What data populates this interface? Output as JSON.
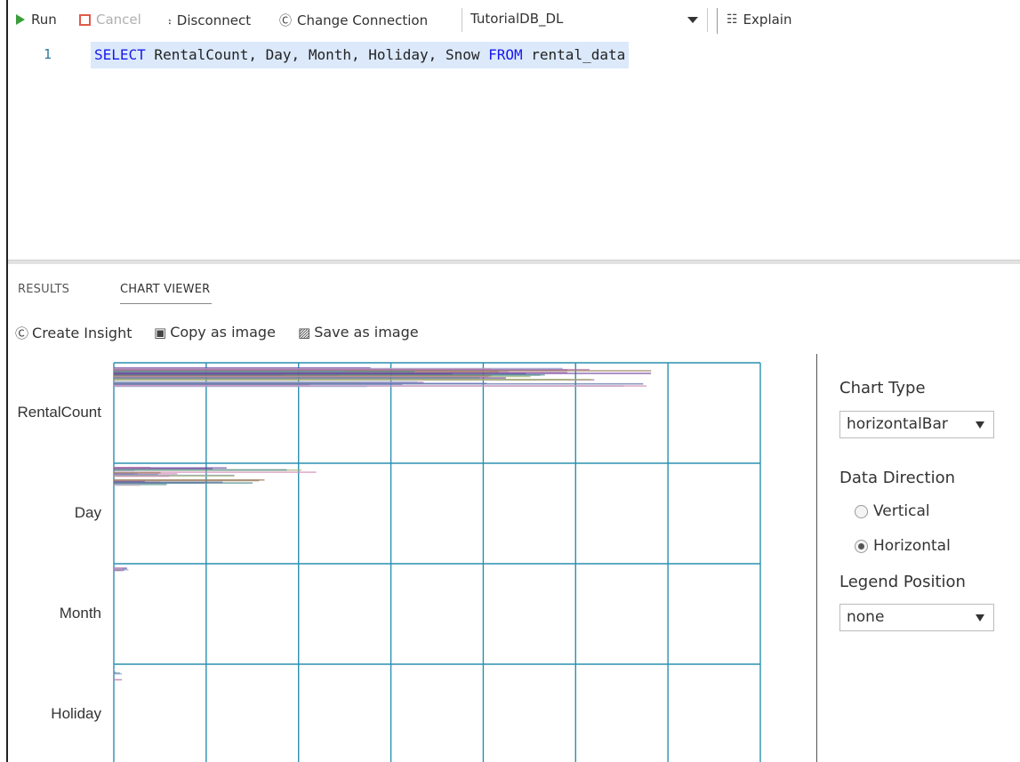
{
  "toolbar": {
    "run_label": "Run",
    "cancel_label": "Cancel",
    "disconnect_label": "Disconnect",
    "change_connection_label": "Change Connection",
    "database": "TutorialDB_DL",
    "explain_label": "Explain"
  },
  "editor": {
    "line_number": "1",
    "query": {
      "select_keyword": "SELECT",
      "columns": " RentalCount, Day, Month, Holiday, Snow ",
      "from_keyword": "FROM",
      "table": " rental_data"
    }
  },
  "results_panel": {
    "tabs": [
      {
        "label": "RESULTS",
        "active": false
      },
      {
        "label": "CHART VIEWER",
        "active": true
      }
    ],
    "actions": {
      "create_insight": "Create Insight",
      "copy_as_image": "Copy as image",
      "save_as_image": "Save as image"
    }
  },
  "chart_settings": {
    "chart_type_label": "Chart Type",
    "chart_type_value": "horizontalBar",
    "data_direction_label": "Data Direction",
    "direction_options": [
      "Vertical",
      "Horizontal"
    ],
    "direction_selected": "Horizontal",
    "legend_position_label": "Legend Position",
    "legend_position_value": "none"
  },
  "chart_data": {
    "type": "bar",
    "orientation": "horizontal",
    "categories": [
      "RentalCount",
      "Day",
      "Month",
      "Holiday"
    ],
    "grid": true,
    "gridline_color": "#2a8fb0",
    "legend": "none",
    "series_colors": [
      "#6a3fa0",
      "#d08ab4",
      "#7b8cc4",
      "#9b7a5a",
      "#4a8a8a",
      "#b06a9e",
      "#8a9bd0",
      "#c0a0c0",
      "#5a6fa8",
      "#a0b070"
    ],
    "value_ranges": {
      "RentalCount": [
        0.15,
        0.85
      ],
      "Day": [
        0.03,
        0.36
      ],
      "Month": [
        0.01,
        0.03
      ],
      "Holiday": [
        0.0,
        0.03
      ]
    }
  }
}
